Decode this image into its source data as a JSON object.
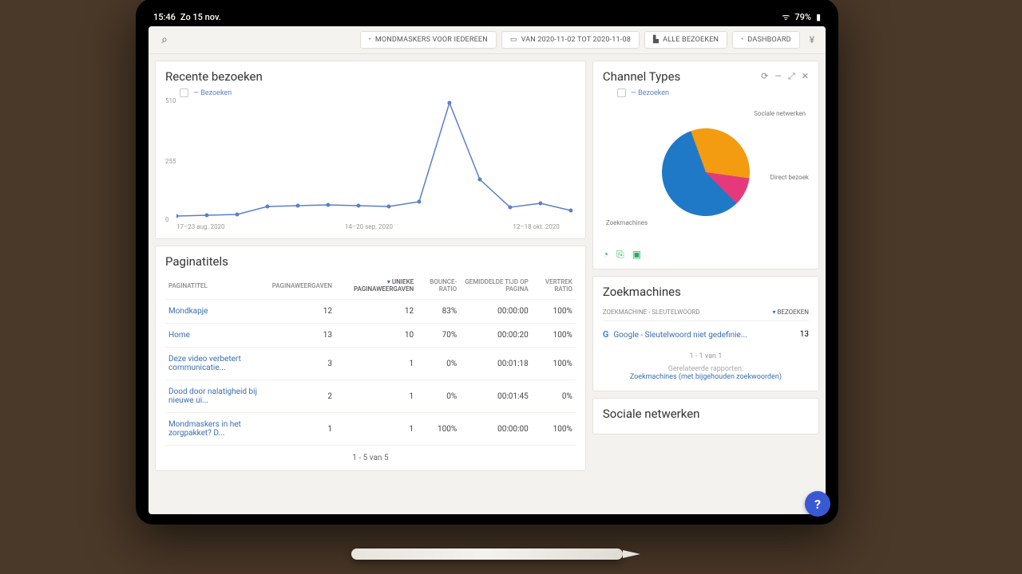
{
  "status": {
    "time": "15:46",
    "date": "Zo 15 nov.",
    "battery": "79%"
  },
  "topbar": {
    "btn1": "MONDMASKERS VOOR IEDEREEN",
    "btn2": "VAN 2020-11-02 TOT 2020-11-08",
    "btn3": "ALLE BEZOEKEN",
    "btn4": "DASHBOARD"
  },
  "visits_card": {
    "title": "Recente bezoeken",
    "legend": "Bezoeken"
  },
  "chart_data": {
    "type": "line",
    "title": "Recente bezoeken",
    "ylabel": "",
    "ylim": [
      0,
      510
    ],
    "yticks": [
      0,
      255,
      510
    ],
    "xticks": [
      "17–23 aug. 2020",
      "14–20 sep. 2020",
      "12–18 okt. 2020"
    ],
    "series": [
      {
        "name": "Bezoeken",
        "values": [
          15,
          18,
          20,
          55,
          60,
          62,
          60,
          58,
          80,
          500,
          175,
          55,
          70,
          40
        ],
        "color": "#5b7fc7"
      }
    ]
  },
  "table": {
    "title": "Paginatitels",
    "cols": [
      "PAGINATITEL",
      "PAGINAWEERGAVEN",
      "UNIEKE PAGINAWEERGAVEN",
      "BOUNCE-RATIO",
      "GEMIDDELDE TIJD OP PAGINA",
      "VERTREK RATIO"
    ],
    "rows": [
      {
        "t": "Mondkapje",
        "pv": "12",
        "upv": "12",
        "br": "83%",
        "avg": "00:00:00",
        "ex": "100%"
      },
      {
        "t": "Home",
        "pv": "13",
        "upv": "10",
        "br": "70%",
        "avg": "00:00:20",
        "ex": "100%"
      },
      {
        "t": "Deze video verbetert communicatie...",
        "pv": "3",
        "upv": "1",
        "br": "0%",
        "avg": "00:01:18",
        "ex": "100%"
      },
      {
        "t": "Dood door nalatigheid bij nieuwe ui...",
        "pv": "2",
        "upv": "1",
        "br": "0%",
        "avg": "00:01:45",
        "ex": "0%"
      },
      {
        "t": "Mondmaskers in het zorgpakket? D...",
        "pv": "1",
        "upv": "1",
        "br": "100%",
        "avg": "00:00:00",
        "ex": "100%"
      }
    ],
    "pager": "1 - 5 van 5"
  },
  "channels": {
    "title": "Channel Types",
    "legend": "Bezoeken",
    "labels": {
      "social": "Sociale netwerken",
      "direct": "Direct bezoek",
      "search": "Zoekmachines"
    }
  },
  "pie_data": {
    "type": "pie",
    "series": [
      {
        "name": "Sociale netwerken",
        "value": 33,
        "color": "#f39c12"
      },
      {
        "name": "Direct bezoek",
        "value": 10,
        "color": "#e6397b"
      },
      {
        "name": "Zoekmachines",
        "value": 57,
        "color": "#2079c7"
      }
    ]
  },
  "search_engines": {
    "title": "Zoekmachines",
    "col1": "ZOEKMACHINE - SLEUTELWOORD",
    "col2": "BEZOEKEN",
    "row_text": "Google - Sleutelwoord niet gedefinie...",
    "row_val": "13",
    "pager": "1 - 1 van 1",
    "related_label": "Gerelateerde rapporten:",
    "related_link": "Zoekmachines (met bijgehouden zoekwoorden)"
  },
  "social_card": {
    "title": "Sociale netwerken"
  }
}
